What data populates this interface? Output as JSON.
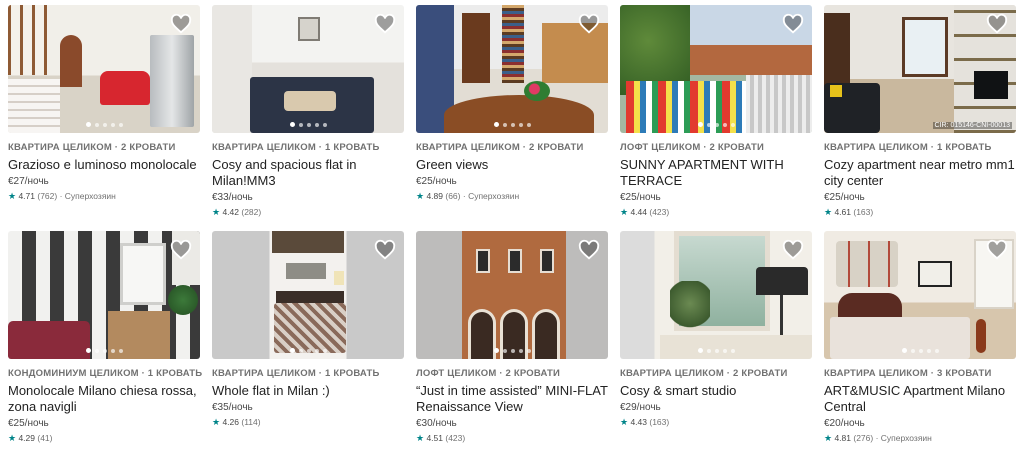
{
  "accent_color": "#008489",
  "heart_icon": "heart-outline-icon",
  "star_icon": "star-icon",
  "listings": [
    {
      "type": "КВАРТИРА ЦЕЛИКОМ · 2 КРОВАТИ",
      "title": "Grazioso e luminoso monolocale",
      "price": "€27/ночь",
      "rating": "4.71",
      "reviews": "(762)",
      "superhost": "· Суперхозяин",
      "active_photo": 1,
      "photo_count": 5,
      "watermark": ""
    },
    {
      "type": "КВАРТИРА ЦЕЛИКОМ · 1 КРОВАТЬ",
      "title": "Cosy and spacious flat in Milan!MM3",
      "price": "€33/ночь",
      "rating": "4.42",
      "reviews": "(282)",
      "superhost": "",
      "active_photo": 1,
      "photo_count": 5,
      "watermark": ""
    },
    {
      "type": "КВАРТИРА ЦЕЛИКОМ · 2 КРОВАТИ",
      "title": "Green views",
      "price": "€25/ночь",
      "rating": "4.89",
      "reviews": "(66)",
      "superhost": "· Суперхозяин",
      "active_photo": 1,
      "photo_count": 5,
      "watermark": ""
    },
    {
      "type": "ЛОФТ ЦЕЛИКОМ · 2 КРОВАТИ",
      "title": "SUNNY APARTMENT WITH TERRACE",
      "price": "€25/ночь",
      "rating": "4.44",
      "reviews": "(423)",
      "superhost": "",
      "active_photo": 1,
      "photo_count": 5,
      "watermark": ""
    },
    {
      "type": "КВАРТИРА ЦЕЛИКОМ · 1 КРОВАТЬ",
      "title": "Cozy apartment near metro mm1 city center",
      "price": "€25/ночь",
      "rating": "4.61",
      "reviews": "(163)",
      "superhost": "",
      "active_photo": 1,
      "photo_count": 5,
      "watermark": "CIR: 015146-CNI-00013"
    },
    {
      "type": "КОНДОМИНИУМ ЦЕЛИКОМ · 1 КРОВАТЬ",
      "title": "Monolocale Milano chiesa rossa, zona navigli",
      "price": "€25/ночь",
      "rating": "4.29",
      "reviews": "(41)",
      "superhost": "",
      "active_photo": 1,
      "photo_count": 5,
      "watermark": ""
    },
    {
      "type": "КВАРТИРА ЦЕЛИКОМ · 1 КРОВАТЬ",
      "title": "Whole flat in Milan :)",
      "price": "€35/ночь",
      "rating": "4.26",
      "reviews": "(114)",
      "superhost": "",
      "active_photo": 1,
      "photo_count": 5,
      "watermark": ""
    },
    {
      "type": "ЛОФТ ЦЕЛИКОМ · 2 КРОВАТИ",
      "title": "“Just in time assisted” MINI-FLAT Renaissance View",
      "price": "€30/ночь",
      "rating": "4.51",
      "reviews": "(423)",
      "superhost": "",
      "active_photo": 1,
      "photo_count": 5,
      "watermark": ""
    },
    {
      "type": "КВАРТИРА ЦЕЛИКОМ · 2 КРОВАТИ",
      "title": "Cosy & smart studio",
      "price": "€29/ночь",
      "rating": "4.43",
      "reviews": "(163)",
      "superhost": "",
      "active_photo": 1,
      "photo_count": 5,
      "watermark": ""
    },
    {
      "type": "КВАРТИРА ЦЕЛИКОМ · 3 КРОВАТИ",
      "title": "ART&MUSIC Apartment Milano Central",
      "price": "€20/ночь",
      "rating": "4.81",
      "reviews": "(276)",
      "superhost": "· Суперхозяин",
      "active_photo": 1,
      "photo_count": 5,
      "watermark": ""
    }
  ]
}
